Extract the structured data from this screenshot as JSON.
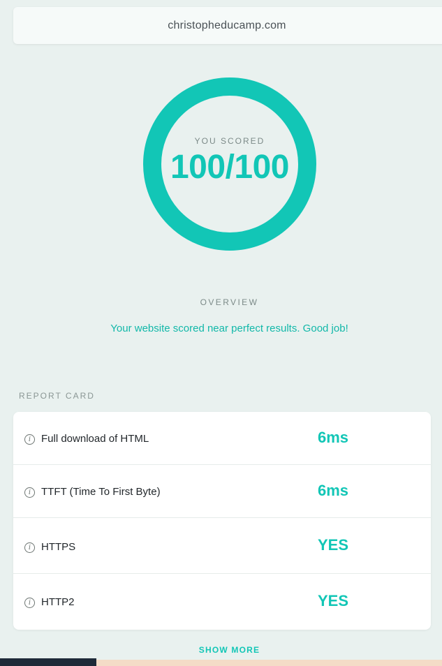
{
  "header": {
    "url": "christopheducamp.com"
  },
  "score": {
    "caption": "YOU SCORED",
    "value": "100/100",
    "fraction": 1.0,
    "color": "#12c6b6"
  },
  "overview": {
    "label": "OVERVIEW",
    "message": "Your website scored near perfect results. Good job!"
  },
  "report": {
    "label": "REPORT CARD",
    "rows": [
      {
        "icon": "info-icon",
        "label": "Full download of HTML",
        "value": "6ms"
      },
      {
        "icon": "info-icon",
        "label": "TTFT (Time To First Byte)",
        "value": "6ms"
      },
      {
        "icon": "info-icon",
        "label": "HTTPS",
        "value": "YES"
      },
      {
        "icon": "info-icon",
        "label": "HTTP2",
        "value": "YES"
      }
    ],
    "show_more_label": "SHOW MORE"
  }
}
